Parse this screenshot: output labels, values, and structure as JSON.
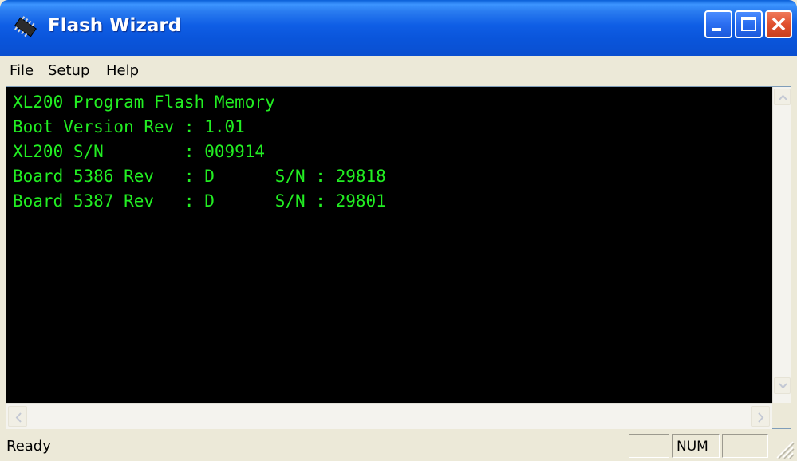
{
  "window": {
    "title": "Flash Wizard",
    "icon": "chip-icon"
  },
  "menu": {
    "items": [
      "File",
      "Setup",
      "Help"
    ]
  },
  "console": {
    "text_color": "#22ee22",
    "background": "#000000",
    "lines": [
      "XL200 Program Flash Memory",
      "Boot Version Rev : 1.01",
      "XL200 S/N        : 009914",
      "Board 5386 Rev   : D      S/N : 29818",
      "Board 5387 Rev   : D      S/N : 29801"
    ]
  },
  "status": {
    "text": "Ready",
    "pane_caps": "",
    "pane_num": "NUM",
    "pane_scrl": ""
  }
}
